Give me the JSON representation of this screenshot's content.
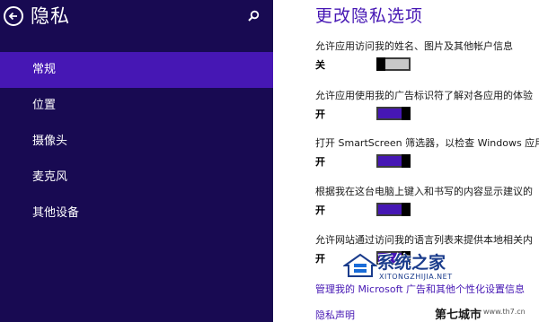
{
  "sidebar": {
    "title": "隐私",
    "items": [
      {
        "label": "常规",
        "selected": true
      },
      {
        "label": "位置",
        "selected": false
      },
      {
        "label": "摄像头",
        "selected": false
      },
      {
        "label": "麦克风",
        "selected": false
      },
      {
        "label": "其他设备",
        "selected": false
      }
    ]
  },
  "main": {
    "title": "更改隐私选项",
    "settings": [
      {
        "label": "允许应用访问我的姓名、图片及其他帐户信息",
        "state": "关",
        "on": false
      },
      {
        "label": "允许应用使用我的广告标识符了解对各应用的体验",
        "state": "开",
        "on": true
      },
      {
        "label": "打开 SmartScreen 筛选器，以检查 Windows 应用",
        "state": "开",
        "on": true
      },
      {
        "label": "根据我在这台电脑上键入和书写的内容显示建议的",
        "state": "开",
        "on": true
      },
      {
        "label": "允许网站通过访问我的语言列表来提供本地相关内",
        "state": "开",
        "on": true
      }
    ],
    "links": {
      "manage": "管理我的 Microsoft 广告和其他个性化设置信息",
      "privacy": "隐私声明"
    }
  },
  "watermarks": {
    "logo_name": "系统之家",
    "logo_url": "XITONGZHIJIA.NET",
    "site_a": "第七城市",
    "site_b": "www.th7.cn"
  },
  "colors": {
    "sidebar_bg": "#180a52",
    "accent": "#4617b4",
    "toggle_off": "#c8c8c8"
  },
  "icons": {
    "back": "back-arrow-icon",
    "search": "search-icon"
  }
}
